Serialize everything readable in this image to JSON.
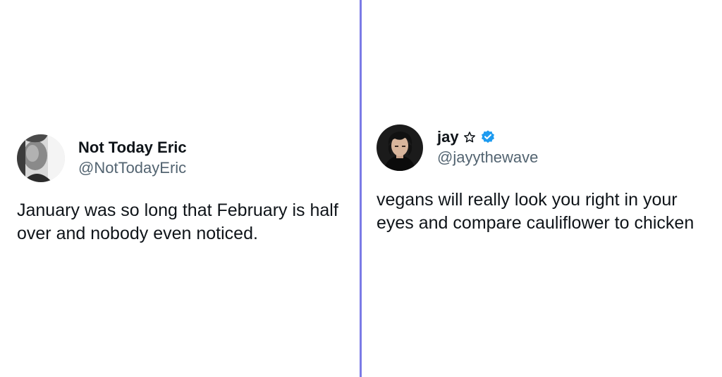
{
  "left_tweet": {
    "display_name": "Not Today Eric",
    "handle": "@NotTodayEric",
    "text": "January was so long that February is half over and nobody even noticed.",
    "avatar_icon": "grayscale-portrait-avatar"
  },
  "right_tweet": {
    "display_name": "jay",
    "star_icon": "outline-star-icon",
    "verified_icon": "verified-badge-icon",
    "verified_color": "#1d9bf0",
    "handle": "@jayythewave",
    "text": "vegans will really look you right in your eyes and compare cauliflower to chicken",
    "avatar_icon": "anime-portrait-avatar"
  },
  "colors": {
    "divider": "#7b7be6",
    "text": "#0f1419",
    "handle": "#536471"
  }
}
